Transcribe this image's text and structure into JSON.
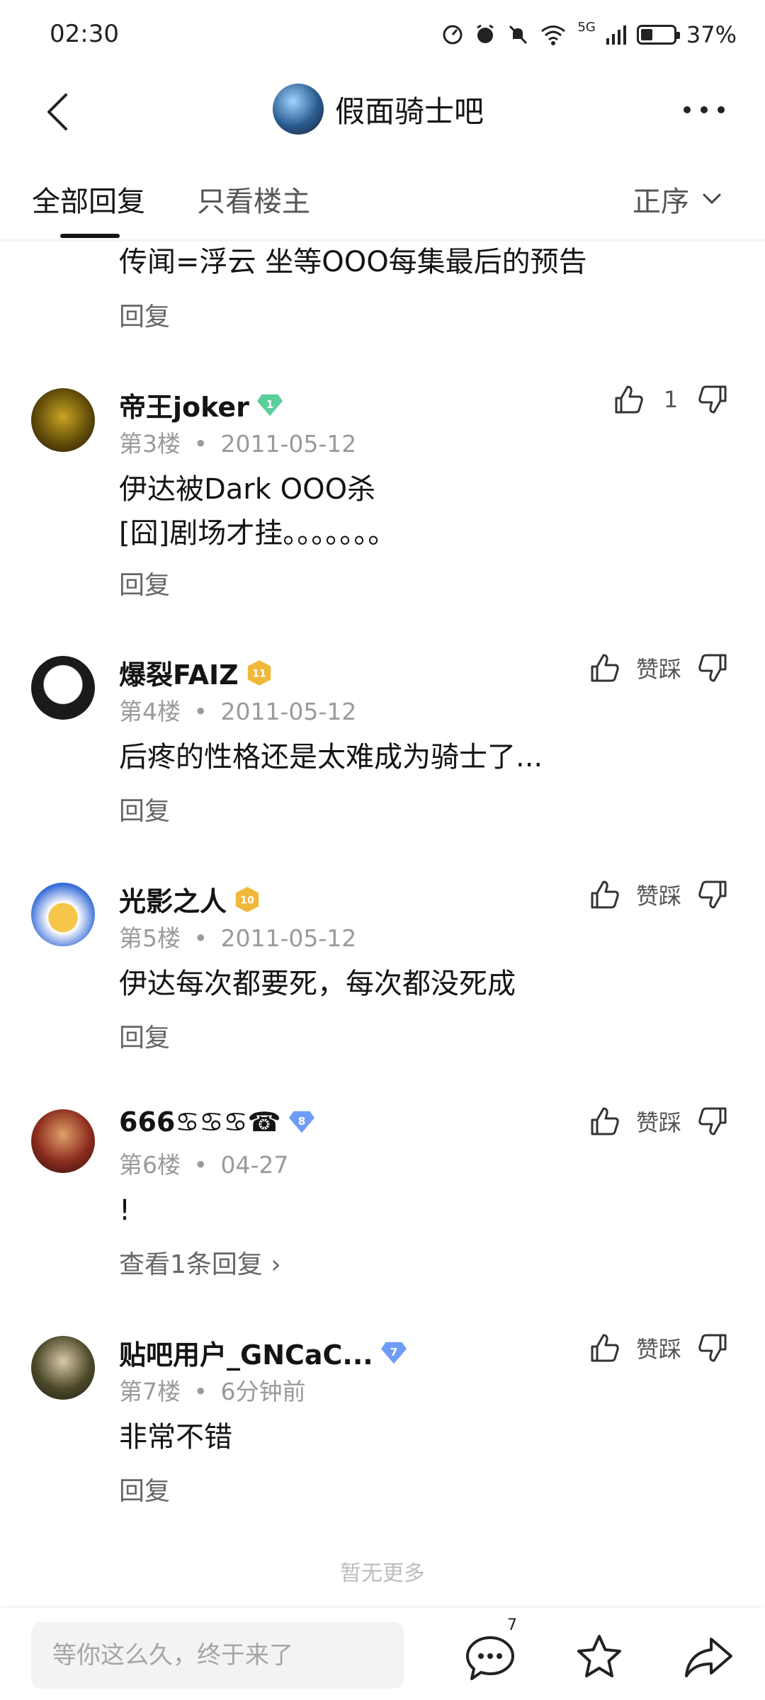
{
  "status_bar": {
    "time": "02:30",
    "battery": "37%",
    "battery_level": 0.37,
    "network_label": "5G",
    "signal_label": "6"
  },
  "header": {
    "forum_name": "假面骑士吧",
    "back_icon": "chevron-left-icon",
    "more_icon": "more-dots-icon"
  },
  "tabs": {
    "all_replies": "全部回复",
    "only_op": "只看楼主",
    "sort_label": "正序"
  },
  "top_partial": {
    "content": "传闻=浮云 坐等OOO每集最后的预告",
    "reply_label": "回复"
  },
  "posts": [
    {
      "username": "帝王joker",
      "level": "1",
      "level_color": "#5ccf9d",
      "floor": "第3楼",
      "date": "2011-05-12",
      "content": "伊达被Dark OOO杀\n[囧]剧场才挂。。。。。。。",
      "like_text": "1",
      "reply_label": "回复"
    },
    {
      "username": "爆裂FAIZ",
      "level": "11",
      "level_color": "#f0b83a",
      "floor": "第4楼",
      "date": "2011-05-12",
      "content": "后疼的性格还是太难成为骑士了...",
      "like_text": "赞踩",
      "reply_label": "回复"
    },
    {
      "username": "光影之人",
      "level": "10",
      "level_color": "#f0b83a",
      "floor": "第5楼",
      "date": "2011-05-12",
      "content": "伊达每次都要死，每次都没死成",
      "like_text": "赞踩",
      "reply_label": "回复"
    },
    {
      "username": "666♋♋♋☎",
      "level": "8",
      "level_color": "#6f9df5",
      "floor": "第6楼",
      "date": "04-27",
      "content": "!",
      "like_text": "赞踩",
      "reply_label": "查看1条回复 ›"
    },
    {
      "username": "贴吧用户_GNCaC...",
      "level": "7",
      "level_color": "#6f9df5",
      "floor": "第7楼",
      "date": "6分钟前",
      "content": "非常不错",
      "like_text": "赞踩",
      "reply_label": "回复"
    }
  ],
  "meta_separator": "•",
  "no_more": "暂无更多",
  "bottom_bar": {
    "input_placeholder": "等你这么久，终于来了",
    "comment_count": "7",
    "comment_icon": "comment-icon",
    "star_icon": "star-icon",
    "share_icon": "share-icon"
  }
}
